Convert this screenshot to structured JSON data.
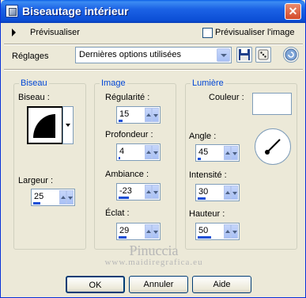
{
  "window": {
    "title": "Biseautage intérieur",
    "close_glyph": "✕"
  },
  "toolbar": {
    "preview_label": "Prévisualiser",
    "preview_image_label": "Prévisualiser l'image",
    "preview_image_checked": false
  },
  "settings": {
    "label": "Réglages",
    "selected": "Dernières options utilisées",
    "save_icon": "floppy-disk-icon",
    "randomize_icon": "dice-icon",
    "reset_icon": "reset-icon"
  },
  "bevel": {
    "group_title": "Biseau",
    "bevel_label": "Biseau :",
    "width_label": "Largeur :",
    "width_value": "25",
    "width_level": 0.25
  },
  "image": {
    "group_title": "Image",
    "smoothness_label": "Régularité :",
    "smoothness_value": "15",
    "smoothness_level": 0.15,
    "depth_label": "Profondeur :",
    "depth_value": "4",
    "depth_level": 0.04,
    "ambience_label": "Ambiance :",
    "ambience_value": "-23",
    "ambience_level": 0.385,
    "shininess_label": "Éclat :",
    "shininess_value": "29",
    "shininess_level": 0.29
  },
  "light": {
    "group_title": "Lumière",
    "color_label": "Couleur :",
    "color_value": "#ffffff",
    "angle_label": "Angle :",
    "angle_value": "45",
    "angle_level": 0.125,
    "intensity_label": "Intensité :",
    "intensity_value": "30",
    "intensity_level": 0.3,
    "elevation_label": "Hauteur :",
    "elevation_value": "50",
    "elevation_level": 0.5
  },
  "watermark": {
    "name": "Pinuccia",
    "site": "www.maidiregrafica.eu"
  },
  "buttons": {
    "ok": "OK",
    "cancel": "Annuler",
    "help": "Aide"
  },
  "colors": {
    "title_bar": "#0c4fd6",
    "group_title": "#0046d5",
    "dialog_bg": "#ece9d8"
  }
}
